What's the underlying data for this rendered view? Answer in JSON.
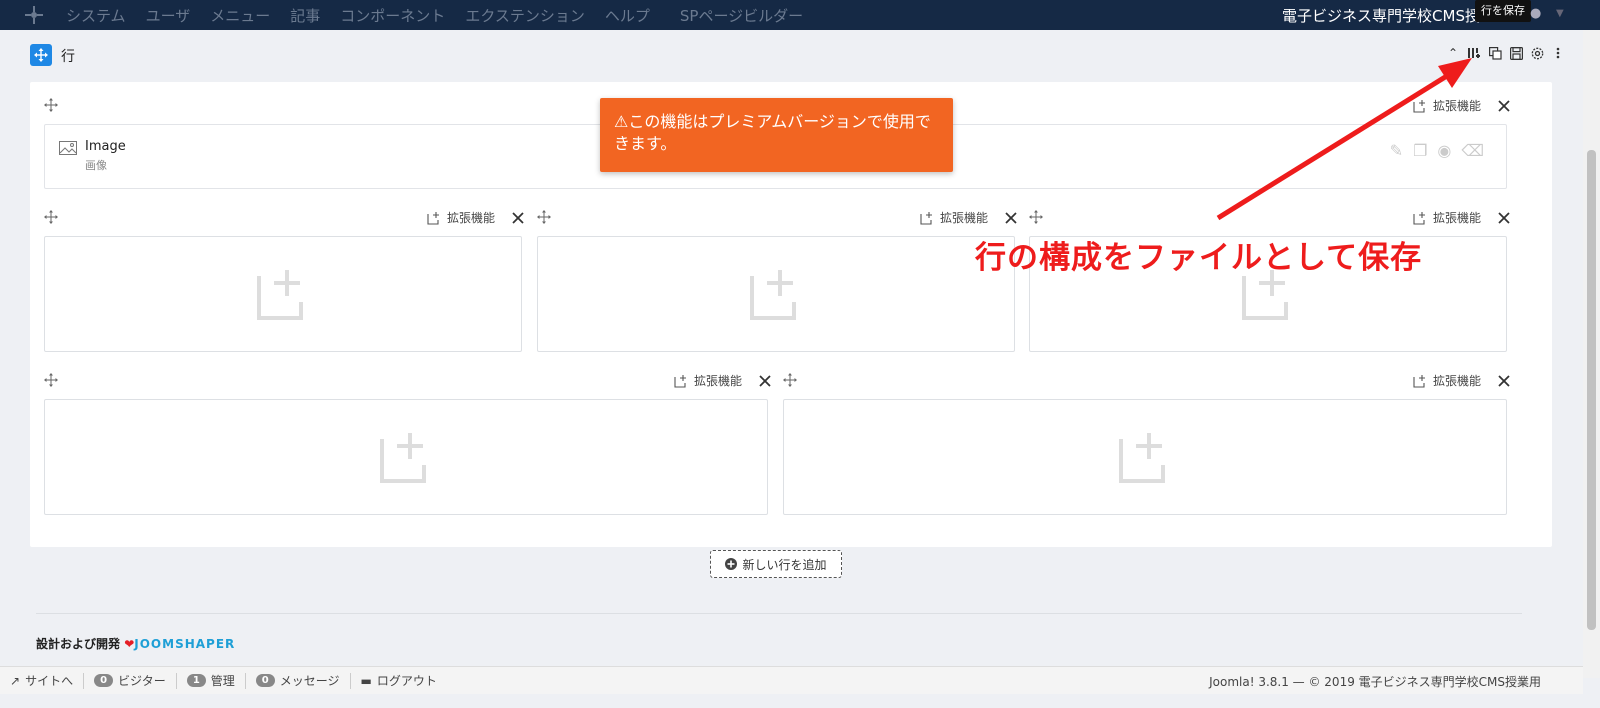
{
  "navbar": {
    "menu": [
      "システム",
      "ユーザ",
      "メニュー",
      "記事",
      "コンポーネント",
      "エクステンション",
      "ヘルプ"
    ],
    "page_builder": "SPページビルダー",
    "site_name": "電子ビジネス専門学校CMS授",
    "tooltip": "行を保存"
  },
  "row": {
    "title": "行",
    "addon_label": "拡張機能"
  },
  "addon": {
    "title": "Image",
    "subtitle": "画像"
  },
  "alert": {
    "message": "この機能はプレミアムバージョンで使用できます。"
  },
  "annotation": {
    "text": "行の構成をファイルとして保存"
  },
  "add_row": {
    "label": "新しい行を追加"
  },
  "footer": {
    "credit_prefix": "設計および開発",
    "brand": "JOOMSHAPER"
  },
  "statusbar": {
    "view_site": "サイトへ",
    "visitors_count": "0",
    "visitors_label": "ビジター",
    "admin_count": "1",
    "admin_label": "管理",
    "messages_count": "0",
    "messages_label": "メッセージ",
    "logout": "ログアウト",
    "copyright": "Joomla! 3.8.1 — © 2019 電子ビジネス専門学校CMS授業用"
  },
  "colors": {
    "navbar": "#152945",
    "accent": "#1e88e5",
    "alert": "#f26522",
    "annotation": "#ee1c1c"
  }
}
